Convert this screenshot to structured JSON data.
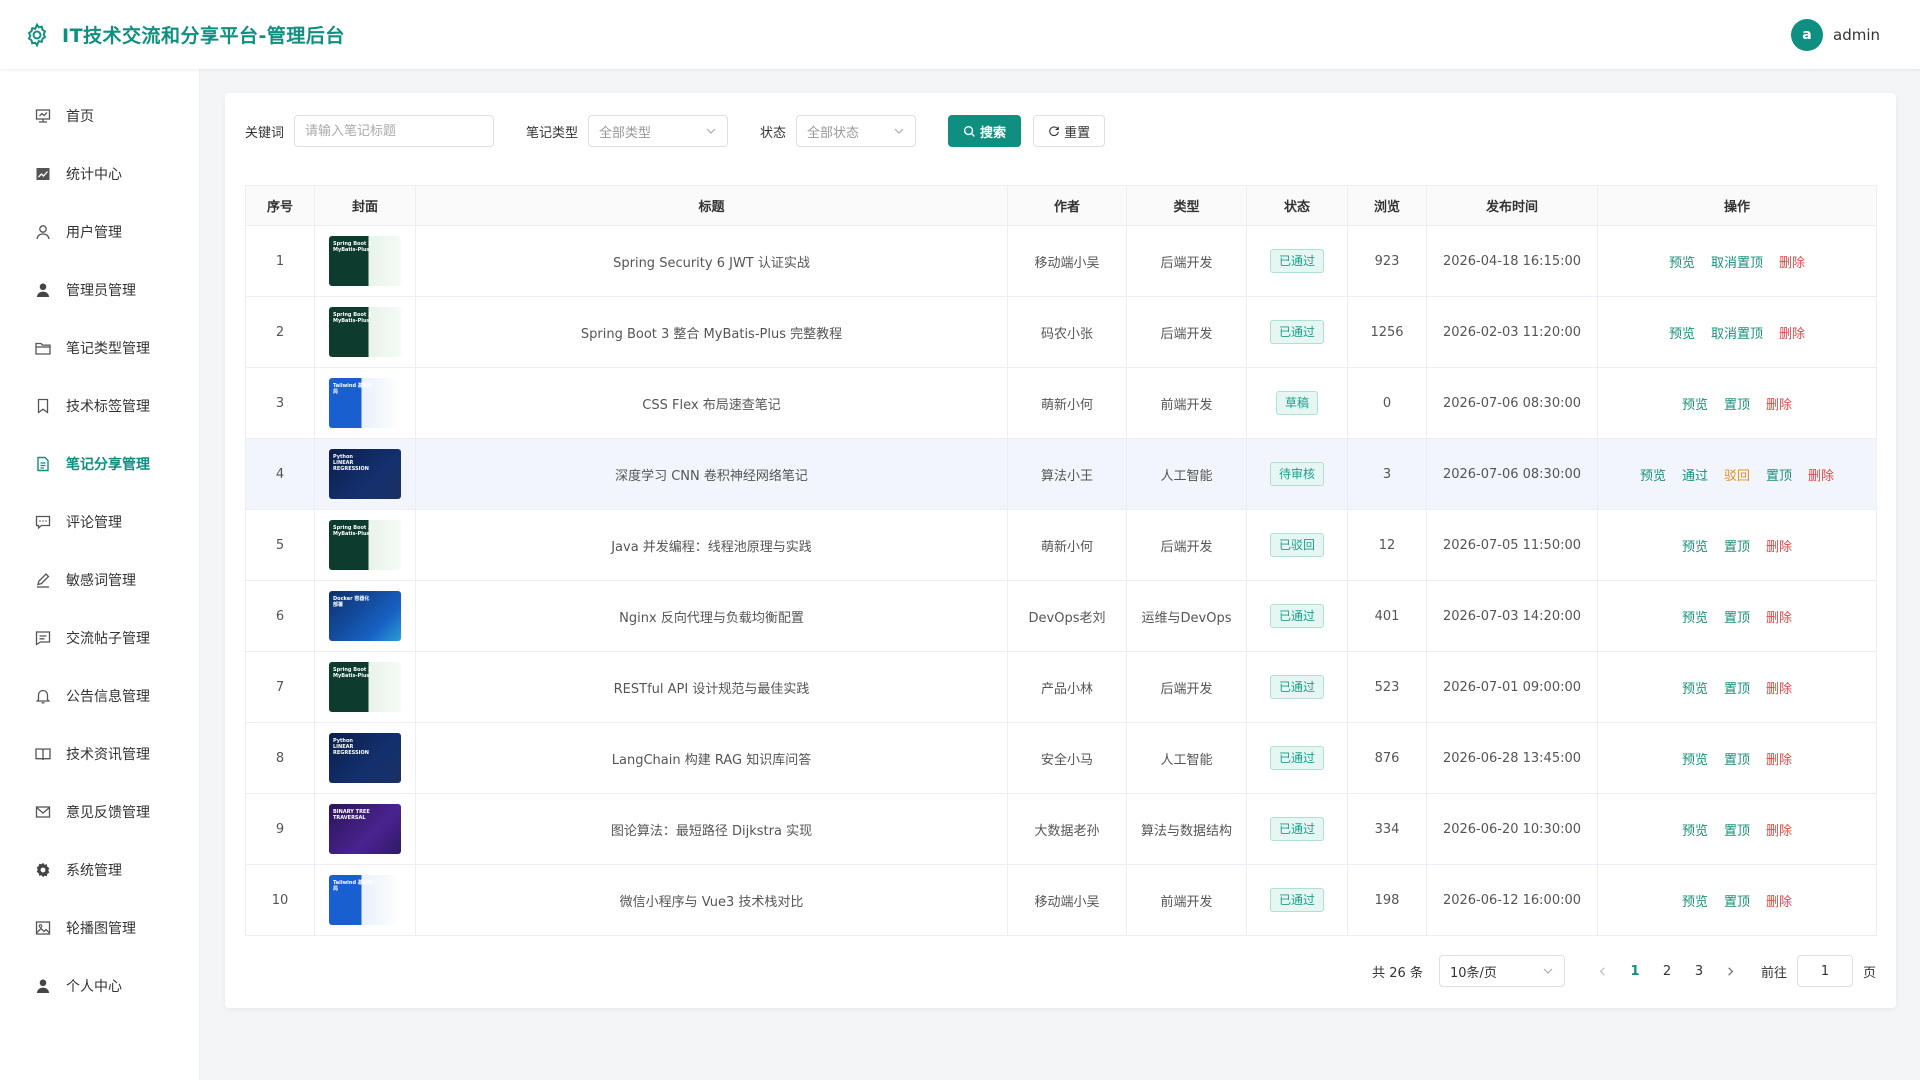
{
  "app": {
    "title": "IT技术交流和分享平台-管理后台",
    "brand_color": "#0f8f80",
    "user": {
      "avatar_letter": "a",
      "name": "admin"
    }
  },
  "sidebar": {
    "items": [
      {
        "label": "首页",
        "icon": "home-icon"
      },
      {
        "label": "统计中心",
        "icon": "chart-icon"
      },
      {
        "label": "用户管理",
        "icon": "user-outline-icon"
      },
      {
        "label": "管理员管理",
        "icon": "user-solid-icon"
      },
      {
        "label": "笔记类型管理",
        "icon": "folder-icon"
      },
      {
        "label": "技术标签管理",
        "icon": "bookmark-icon"
      },
      {
        "label": "笔记分享管理",
        "icon": "document-icon",
        "active": true
      },
      {
        "label": "评论管理",
        "icon": "comment-icon"
      },
      {
        "label": "敏感词管理",
        "icon": "edit-icon"
      },
      {
        "label": "交流帖子管理",
        "icon": "message-icon"
      },
      {
        "label": "公告信息管理",
        "icon": "bell-icon"
      },
      {
        "label": "技术资讯管理",
        "icon": "book-icon"
      },
      {
        "label": "意见反馈管理",
        "icon": "mail-icon"
      },
      {
        "label": "系统管理",
        "icon": "gear-icon"
      },
      {
        "label": "轮播图管理",
        "icon": "picture-icon"
      },
      {
        "label": "个人中心",
        "icon": "person-icon"
      }
    ]
  },
  "filters": {
    "keyword_label": "关键词",
    "keyword_placeholder": "请输入笔记标题",
    "type_label": "笔记类型",
    "type_value": "全部类型",
    "status_label": "状态",
    "status_value": "全部状态",
    "search_label": "搜索",
    "reset_label": "重置"
  },
  "table": {
    "headers": [
      "序号",
      "封面",
      "标题",
      "作者",
      "类型",
      "状态",
      "浏览",
      "发布时间",
      "操作"
    ],
    "rows": [
      {
        "no": "1",
        "cover": "spring",
        "cover_text": "Spring Boot 3 MyBatis-Plus",
        "title": "Spring Security 6 JWT 认证实战",
        "author": "移动端小吴",
        "type": "后端开发",
        "status": "已通过",
        "views": "923",
        "time": "2026-04-18 16:15:00",
        "ops": [
          "预览",
          "取消置顶",
          "删除"
        ]
      },
      {
        "no": "2",
        "cover": "spring",
        "cover_text": "Spring Boot 3 MyBatis-Plus",
        "title": "Spring Boot 3 整合 MyBatis-Plus 完整教程",
        "author": "码农小张",
        "type": "后端开发",
        "status": "已通过",
        "views": "1256",
        "time": "2026-02-03 11:20:00",
        "ops": [
          "预览",
          "取消置顶",
          "删除"
        ]
      },
      {
        "no": "3",
        "cover": "blue",
        "cover_text": "Tailwind 基础布局",
        "title": "CSS Flex 布局速查笔记",
        "author": "萌新小何",
        "type": "前端开发",
        "status": "草稿",
        "views": "0",
        "time": "2026-07-06 08:30:00",
        "ops": [
          "预览",
          "置顶",
          "删除"
        ]
      },
      {
        "no": "4",
        "cover": "python",
        "cover_text": "Python LINEAR REGRESSION",
        "title": "深度学习 CNN 卷积神经网络笔记",
        "author": "算法小王",
        "type": "人工智能",
        "status": "待审核",
        "views": "3",
        "time": "2026-07-06 08:30:00",
        "ops": [
          "预览",
          "通过",
          "驳回",
          "置顶",
          "删除"
        ]
      },
      {
        "no": "5",
        "cover": "spring",
        "cover_text": "Spring Boot 3 MyBatis-Plus",
        "title": "Java 并发编程：线程池原理与实践",
        "author": "萌新小何",
        "type": "后端开发",
        "status": "已驳回",
        "views": "12",
        "time": "2026-07-05 11:50:00",
        "ops": [
          "预览",
          "置顶",
          "删除"
        ]
      },
      {
        "no": "6",
        "cover": "docker",
        "cover_text": "Docker 容器化部署",
        "title": "Nginx 反向代理与负载均衡配置",
        "author": "DevOps老刘",
        "type": "运维与DevOps",
        "status": "已通过",
        "views": "401",
        "time": "2026-07-03 14:20:00",
        "ops": [
          "预览",
          "置顶",
          "删除"
        ]
      },
      {
        "no": "7",
        "cover": "spring",
        "cover_text": "Spring Boot 3 MyBatis-Plus",
        "title": "RESTful API 设计规范与最佳实践",
        "author": "产品小林",
        "type": "后端开发",
        "status": "已通过",
        "views": "523",
        "time": "2026-07-01 09:00:00",
        "ops": [
          "预览",
          "置顶",
          "删除"
        ]
      },
      {
        "no": "8",
        "cover": "python",
        "cover_text": "Python LINEAR REGRESSION",
        "title": "LangChain 构建 RAG 知识库问答",
        "author": "安全小马",
        "type": "人工智能",
        "status": "已通过",
        "views": "876",
        "time": "2026-06-28 13:45:00",
        "ops": [
          "预览",
          "置顶",
          "删除"
        ]
      },
      {
        "no": "9",
        "cover": "tree",
        "cover_text": "BINARY TREE TRAVERSAL",
        "title": "图论算法：最短路径 Dijkstra 实现",
        "author": "大数据老孙",
        "type": "算法与数据结构",
        "status": "已通过",
        "views": "334",
        "time": "2026-06-20 10:30:00",
        "ops": [
          "预览",
          "置顶",
          "删除"
        ]
      },
      {
        "no": "10",
        "cover": "blue",
        "cover_text": "Tailwind 基础布局",
        "title": "微信小程序与 Vue3 技术栈对比",
        "author": "移动端小吴",
        "type": "前端开发",
        "status": "已通过",
        "views": "198",
        "time": "2026-06-12 16:00:00",
        "ops": [
          "预览",
          "置顶",
          "删除"
        ]
      }
    ]
  },
  "pagination": {
    "total": "共 26 条",
    "page_size": "10条/页",
    "pages": [
      "1",
      "2",
      "3"
    ],
    "current": "1",
    "goto_label": "前往",
    "goto_value": "1",
    "page_suffix": "页"
  }
}
